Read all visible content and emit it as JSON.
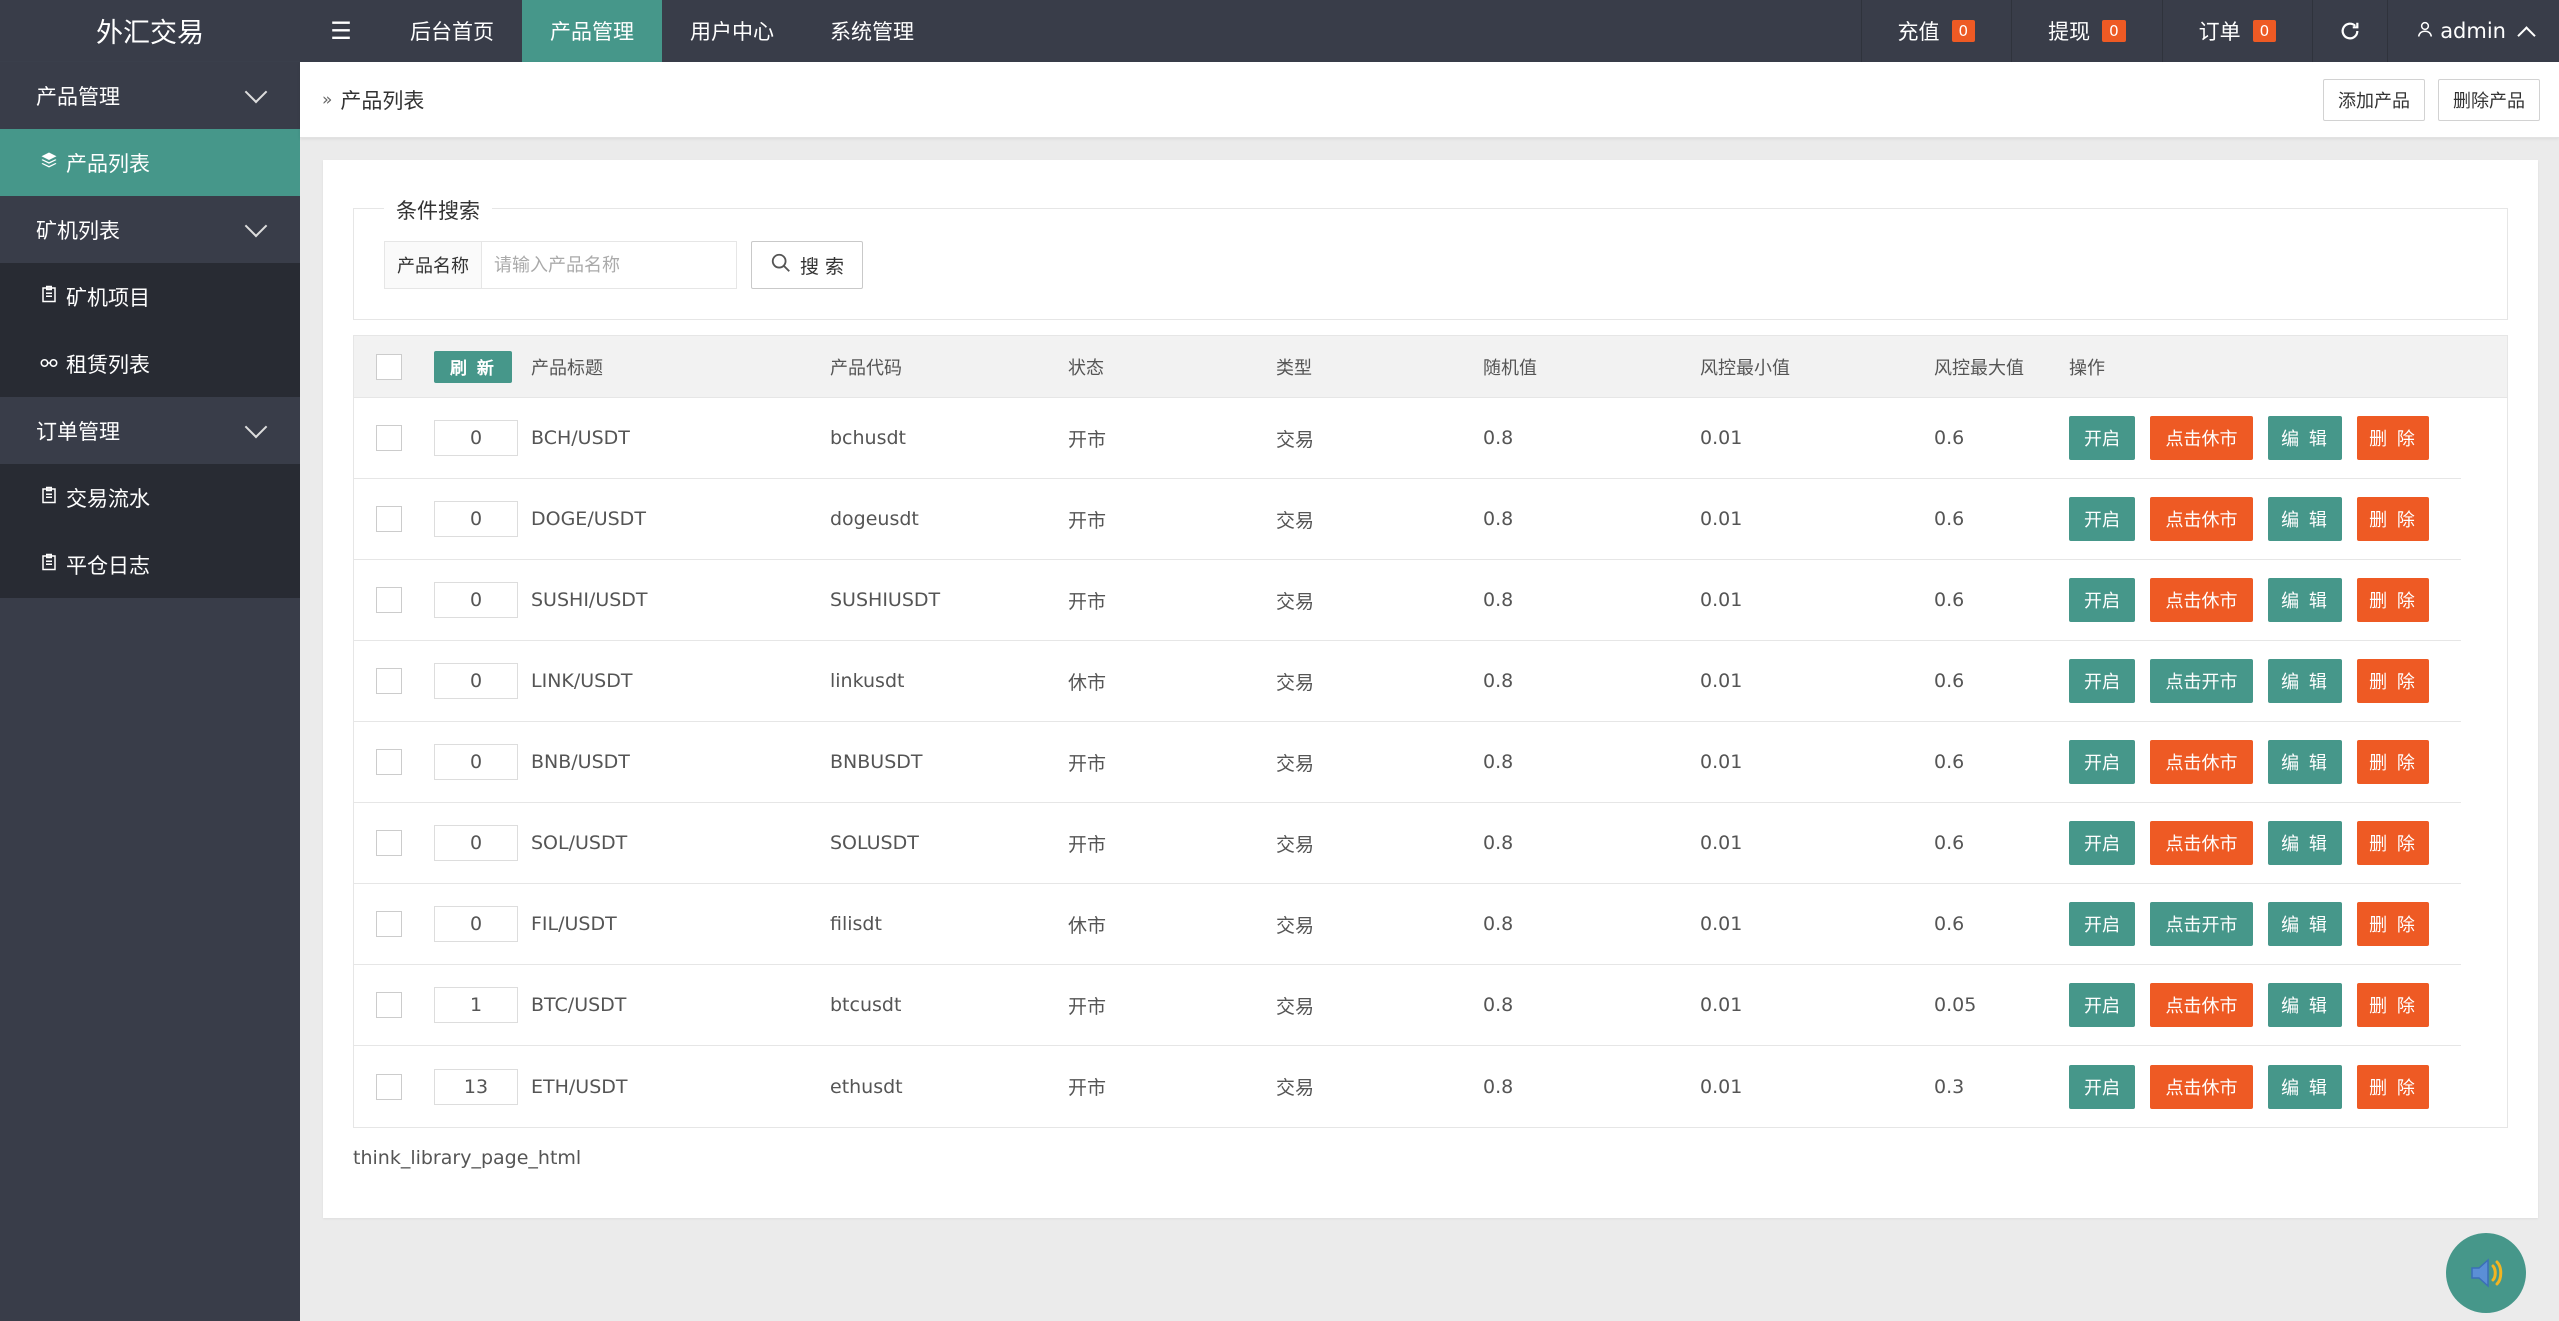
{
  "brand": "外汇交易",
  "top_nav": {
    "items": [
      "后台首页",
      "产品管理",
      "用户中心",
      "系统管理"
    ],
    "active_index": 1
  },
  "top_right": {
    "recharge_label": "充值",
    "recharge_count": "0",
    "withdraw_label": "提现",
    "withdraw_count": "0",
    "order_label": "订单",
    "order_count": "0",
    "username": "admin"
  },
  "sidebar": {
    "groups": [
      {
        "label": "产品管理",
        "items": [
          {
            "label": "产品列表",
            "icon": "layers-icon",
            "active": true
          }
        ]
      },
      {
        "label": "矿机列表",
        "items": [
          {
            "label": "矿机项目",
            "icon": "clipboard-icon"
          },
          {
            "label": "租赁列表",
            "icon": "link-icon"
          }
        ]
      },
      {
        "label": "订单管理",
        "items": [
          {
            "label": "交易流水",
            "icon": "clipboard-icon"
          },
          {
            "label": "平仓日志",
            "icon": "clipboard-icon"
          }
        ]
      }
    ]
  },
  "breadcrumb": {
    "title": "产品列表"
  },
  "actions": {
    "add": "添加产品",
    "delete": "删除产品"
  },
  "search": {
    "legend": "条件搜索",
    "label": "产品名称",
    "placeholder": "请输入产品名称",
    "value": "",
    "button": "搜 索"
  },
  "table": {
    "refresh_label": "刷 新",
    "headers": [
      "产品标题",
      "产品代码",
      "状态",
      "类型",
      "随机值",
      "风控最小值",
      "风控最大值",
      "操作"
    ],
    "rows": [
      {
        "sort": "0",
        "title": "BCH/USDT",
        "code": "bchusdt",
        "status": "开市",
        "type": "交易",
        "rand": "0.8",
        "min": "0.01",
        "max": "0.6",
        "toggle": "点击休市"
      },
      {
        "sort": "0",
        "title": "DOGE/USDT",
        "code": "dogeusdt",
        "status": "开市",
        "type": "交易",
        "rand": "0.8",
        "min": "0.01",
        "max": "0.6",
        "toggle": "点击休市"
      },
      {
        "sort": "0",
        "title": "SUSHI/USDT",
        "code": "SUSHIUSDT",
        "status": "开市",
        "type": "交易",
        "rand": "0.8",
        "min": "0.01",
        "max": "0.6",
        "toggle": "点击休市"
      },
      {
        "sort": "0",
        "title": "LINK/USDT",
        "code": "linkusdt",
        "status": "休市",
        "type": "交易",
        "rand": "0.8",
        "min": "0.01",
        "max": "0.6",
        "toggle": "点击开市"
      },
      {
        "sort": "0",
        "title": "BNB/USDT",
        "code": "BNBUSDT",
        "status": "开市",
        "type": "交易",
        "rand": "0.8",
        "min": "0.01",
        "max": "0.6",
        "toggle": "点击休市"
      },
      {
        "sort": "0",
        "title": "SOL/USDT",
        "code": "SOLUSDT",
        "status": "开市",
        "type": "交易",
        "rand": "0.8",
        "min": "0.01",
        "max": "0.6",
        "toggle": "点击休市"
      },
      {
        "sort": "0",
        "title": "FIL/USDT",
        "code": "filisdt",
        "status": "休市",
        "type": "交易",
        "rand": "0.8",
        "min": "0.01",
        "max": "0.6",
        "toggle": "点击开市"
      },
      {
        "sort": "1",
        "title": "BTC/USDT",
        "code": "btcusdt",
        "status": "开市",
        "type": "交易",
        "rand": "0.8",
        "min": "0.01",
        "max": "0.05",
        "toggle": "点击休市"
      },
      {
        "sort": "13",
        "title": "ETH/USDT",
        "code": "ethusdt",
        "status": "开市",
        "type": "交易",
        "rand": "0.8",
        "min": "0.01",
        "max": "0.3",
        "toggle": "点击休市"
      }
    ],
    "op_open": "开启",
    "op_edit": "编 辑",
    "op_delete": "删 除"
  },
  "pager_text": "think_library_page_html",
  "colors": {
    "dark": "#393d49",
    "sub_dark": "#282b33",
    "green": "#46978a",
    "orange": "#ee5a24"
  }
}
